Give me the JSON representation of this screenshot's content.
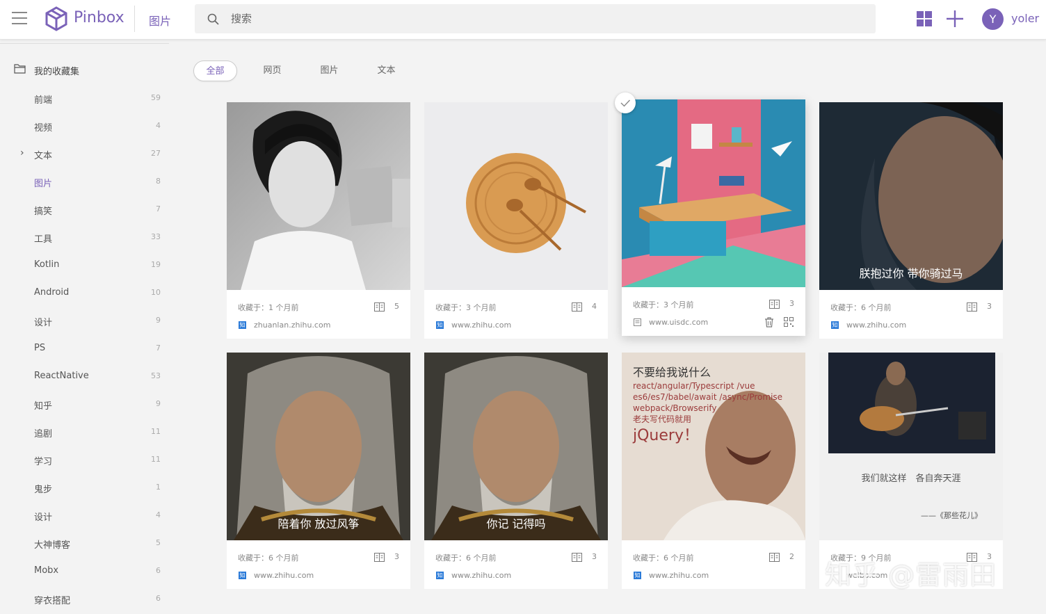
{
  "app": {
    "name": "Pinbox",
    "breadcrumb": "图片",
    "search_placeholder": "搜索",
    "user_initial": "Y",
    "username": "yoler",
    "accent_color": "#7a62b8"
  },
  "sidebar": {
    "root": "我的收藏集",
    "items": [
      {
        "label": "前端",
        "count": "59"
      },
      {
        "label": "视频",
        "count": "4"
      },
      {
        "label": "文本",
        "count": "27",
        "expandable": true
      },
      {
        "label": "图片",
        "count": "8",
        "active": true
      },
      {
        "label": "搞笑",
        "count": "7"
      },
      {
        "label": "工具",
        "count": "33"
      },
      {
        "label": "Kotlin",
        "count": "19"
      },
      {
        "label": "Android",
        "count": "10"
      },
      {
        "label": "设计",
        "count": "9"
      },
      {
        "label": "PS",
        "count": "7"
      },
      {
        "label": "ReactNative",
        "count": "53"
      },
      {
        "label": "知乎",
        "count": "9"
      },
      {
        "label": "追剧",
        "count": "11"
      },
      {
        "label": "学习",
        "count": "11"
      },
      {
        "label": "鬼步",
        "count": "1"
      },
      {
        "label": "设计",
        "count": "4"
      },
      {
        "label": "大神博客",
        "count": "5"
      },
      {
        "label": "Mobx",
        "count": "6"
      },
      {
        "label": "穿衣搭配",
        "count": "6"
      }
    ]
  },
  "filters": [
    "全部",
    "网页",
    "图片",
    "文本"
  ],
  "cards": [
    {
      "saved": "收藏于：1 个月前",
      "count": "5",
      "site": "zhuanlan.zhihu.com",
      "site_icon": "知"
    },
    {
      "saved": "收藏于：3 个月前",
      "count": "4",
      "site": "www.zhihu.com",
      "site_icon": "知"
    },
    {
      "saved": "收藏于：3 个月前",
      "count": "3",
      "site": "www.uisdc.com",
      "site_icon": ""
    },
    {
      "saved": "收藏于：6 个月前",
      "count": "3",
      "site": "www.zhihu.com",
      "site_icon": "知",
      "caption": "朕抱过你 带你骑过马"
    },
    {
      "saved": "收藏于：6 个月前",
      "count": "3",
      "site": "www.zhihu.com",
      "site_icon": "知",
      "caption": "陪着你 放过风筝"
    },
    {
      "saved": "收藏于：6 个月前",
      "count": "3",
      "site": "www.zhihu.com",
      "site_icon": "知",
      "caption": "你记 记得吗"
    },
    {
      "saved": "收藏于：6 个月前",
      "count": "2",
      "site": "www.zhihu.com",
      "site_icon": "知",
      "meme_lines": [
        "不要给我说什么",
        "react/angular/Typescript /vue",
        "es6/es7/babel/await /async/Promise",
        "webpack/Browserify",
        "老夫写代码就用",
        "jQuery！"
      ]
    },
    {
      "saved": "收藏于：9 个月前",
      "count": "3",
      "site": "weibo.com",
      "site_icon": "",
      "poem": "我们就这样　各自奔天涯",
      "poem_sign": "——《那些花儿》"
    }
  ],
  "watermark": "知乎 @雷雨田"
}
